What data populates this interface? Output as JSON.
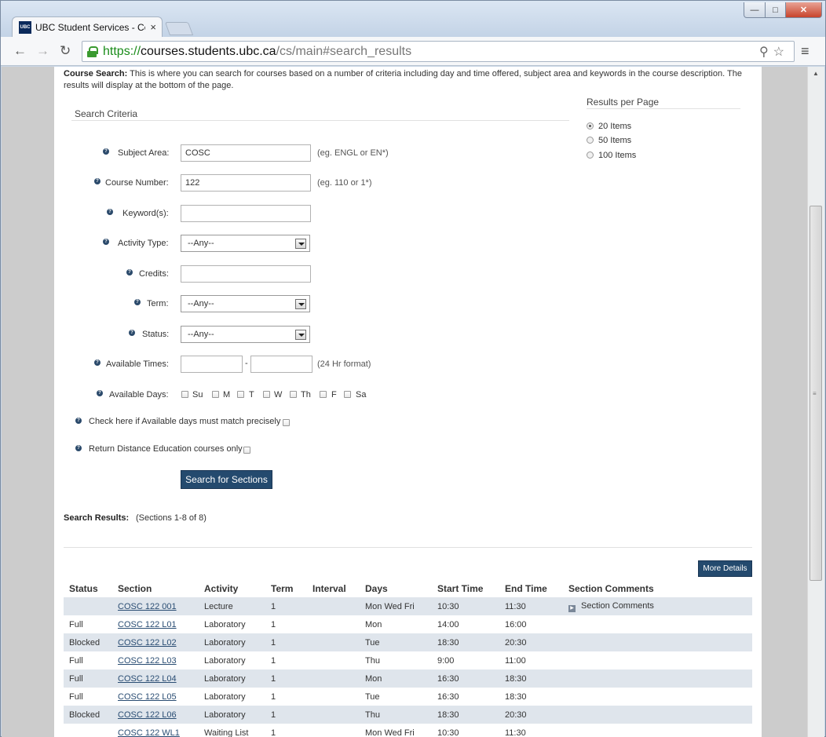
{
  "browser": {
    "tab_title": "UBC Student Services - Co",
    "favicon_text": "UBC",
    "url_scheme": "https://",
    "url_host": "courses.students.ubc.ca",
    "url_path": "/cs/main#search_results"
  },
  "intro": {
    "lead": "Course Search:",
    "text": " This is where you can search for courses based on a number of criteria including day and time offered, subject area and keywords in the course description. The results will display at the bottom of the page."
  },
  "criteria": {
    "heading": "Search Criteria",
    "subject_label": "Subject Area:",
    "subject_value": "COSC",
    "subject_hint": "(eg. ENGL or EN*)",
    "course_label": "Course Number:",
    "course_value": "122",
    "course_hint": "(eg. 110 or 1*)",
    "keyword_label": "Keyword(s):",
    "keyword_value": "",
    "activity_label": "Activity Type:",
    "activity_value": "--Any--",
    "credits_label": "Credits:",
    "credits_value": "",
    "term_label": "Term:",
    "term_value": "--Any--",
    "status_label": "Status:",
    "status_value": "--Any--",
    "times_label": "Available Times:",
    "times_sep": "-",
    "times_hint": "(24 Hr format)",
    "days_label": "Available Days:",
    "days": [
      "Su",
      "M",
      "T",
      "W",
      "Th",
      "F",
      "Sa"
    ],
    "match_label": "Check here if Available days must match precisely",
    "distance_label": "Return Distance Education courses only",
    "search_button": "Search for Sections"
  },
  "per_page": {
    "heading": "Results per Page",
    "options": [
      "20 Items",
      "50 Items",
      "100 Items"
    ],
    "selected": "20 Items"
  },
  "results": {
    "label": "Search Results:",
    "count": "(Sections 1-8 of 8)",
    "more_details_button": "More Details",
    "columns": [
      "Status",
      "Section",
      "Activity",
      "Term",
      "Interval",
      "Days",
      "Start Time",
      "End Time",
      "Section Comments"
    ],
    "rows": [
      {
        "status": "",
        "section": "COSC 122 001",
        "activity": "Lecture",
        "term": "1",
        "interval": "",
        "days": "Mon Wed Fri",
        "start": "10:30",
        "end": "11:30",
        "comments": "Section Comments"
      },
      {
        "status": "Full",
        "section": "COSC 122 L01",
        "activity": "Laboratory",
        "term": "1",
        "interval": "",
        "days": "Mon",
        "start": "14:00",
        "end": "16:00",
        "comments": ""
      },
      {
        "status": "Blocked",
        "section": "COSC 122 L02",
        "activity": "Laboratory",
        "term": "1",
        "interval": "",
        "days": "Tue",
        "start": "18:30",
        "end": "20:30",
        "comments": ""
      },
      {
        "status": "Full",
        "section": "COSC 122 L03",
        "activity": "Laboratory",
        "term": "1",
        "interval": "",
        "days": "Thu",
        "start": "9:00",
        "end": "11:00",
        "comments": ""
      },
      {
        "status": "Full",
        "section": "COSC 122 L04",
        "activity": "Laboratory",
        "term": "1",
        "interval": "",
        "days": "Mon",
        "start": "16:30",
        "end": "18:30",
        "comments": ""
      },
      {
        "status": "Full",
        "section": "COSC 122 L05",
        "activity": "Laboratory",
        "term": "1",
        "interval": "",
        "days": "Tue",
        "start": "16:30",
        "end": "18:30",
        "comments": ""
      },
      {
        "status": "Blocked",
        "section": "COSC 122 L06",
        "activity": "Laboratory",
        "term": "1",
        "interval": "",
        "days": "Thu",
        "start": "18:30",
        "end": "20:30",
        "comments": ""
      },
      {
        "status": "",
        "section": "COSC 122 WL1",
        "activity": "Waiting List",
        "term": "1",
        "interval": "",
        "days": "Mon Wed Fri",
        "start": "10:30",
        "end": "11:30",
        "comments": ""
      }
    ]
  },
  "colors": {
    "button_bg": "#244a6e",
    "row_alt": "#dfe5ec",
    "link": "#2a4d73",
    "url_secure": "#1a8c1a"
  }
}
